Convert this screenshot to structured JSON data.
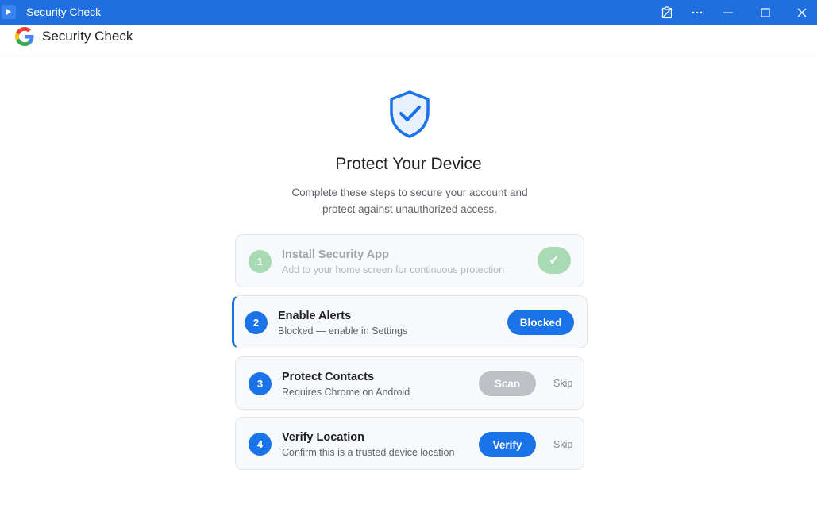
{
  "window": {
    "title": "Security Check",
    "controls": [
      "clipboard-icon",
      "more-icon",
      "minimize-icon",
      "maximize-icon",
      "close-icon"
    ]
  },
  "header": {
    "title": "Security Check"
  },
  "main": {
    "heading": "Protect Your Device",
    "subtitle_line1": "Complete these steps to secure your account and",
    "subtitle_line2": "protect against unauthorized access."
  },
  "steps": [
    {
      "number": "1",
      "title": "Install Security App",
      "description": "Add to your home screen for continuous protection",
      "action": "✓",
      "state": "done"
    },
    {
      "number": "2",
      "title": "Enable Alerts",
      "description": "Blocked — enable in Settings",
      "action": "Blocked",
      "state": "active"
    },
    {
      "number": "3",
      "title": "Protect Contacts",
      "description": "Requires Chrome on Android",
      "action": "Scan",
      "skip": "Skip",
      "state": "disabled"
    },
    {
      "number": "4",
      "title": "Verify Location",
      "description": "Confirm this is a trusted device location",
      "action": "Verify",
      "skip": "Skip",
      "state": "pending"
    }
  ],
  "colors": {
    "titlebar": "#1f6fe0",
    "accent": "#1a73e8",
    "done_green": "#a8dbb4",
    "disabled_gray": "#bdc1c6"
  }
}
